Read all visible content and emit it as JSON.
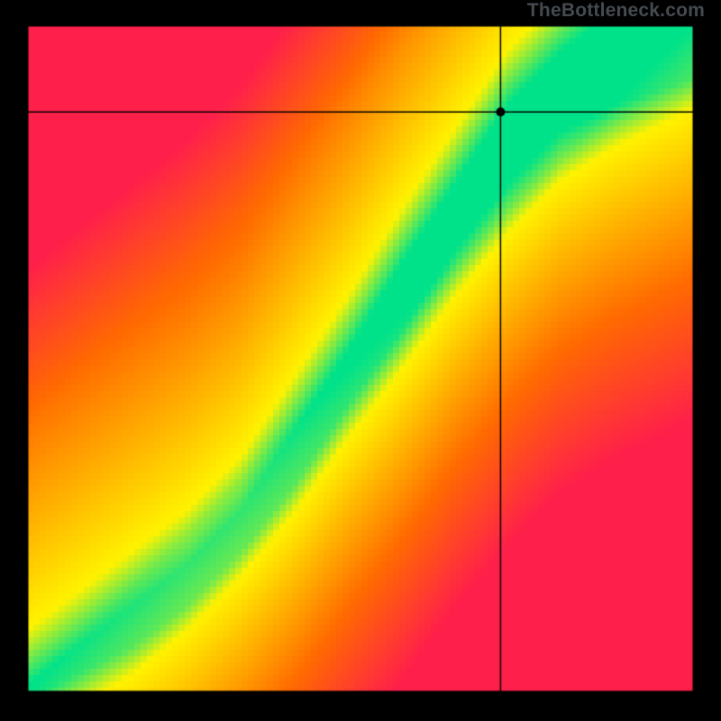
{
  "watermark": "TheBottleneck.com",
  "chart_data": {
    "type": "heatmap",
    "title": "",
    "xlabel": "",
    "ylabel": "",
    "xlim": [
      0,
      100
    ],
    "ylim": [
      0,
      100
    ],
    "crosshair": {
      "x": 71,
      "y": 87
    },
    "marker": {
      "x": 71,
      "y": 87
    },
    "optimal_band": {
      "description": "ideal-balance curve (green) with yellow transition to red further away",
      "curve_points": [
        {
          "x": 0,
          "center": 0,
          "half_width": 1
        },
        {
          "x": 8,
          "center": 5,
          "half_width": 2
        },
        {
          "x": 16,
          "center": 10,
          "half_width": 3
        },
        {
          "x": 24,
          "center": 16,
          "half_width": 3
        },
        {
          "x": 32,
          "center": 24,
          "half_width": 3
        },
        {
          "x": 40,
          "center": 35,
          "half_width": 4
        },
        {
          "x": 48,
          "center": 47,
          "half_width": 4
        },
        {
          "x": 56,
          "center": 59,
          "half_width": 5
        },
        {
          "x": 64,
          "center": 71,
          "half_width": 5
        },
        {
          "x": 72,
          "center": 82,
          "half_width": 6
        },
        {
          "x": 80,
          "center": 90,
          "half_width": 6
        },
        {
          "x": 88,
          "center": 95,
          "half_width": 7
        },
        {
          "x": 100,
          "center": 100,
          "half_width": 8
        }
      ]
    },
    "colors": {
      "ideal": "#00e28a",
      "near": "#fff200",
      "mid": "#ffb000",
      "far": "#ff6a00",
      "worst": "#ff1f4b"
    }
  }
}
